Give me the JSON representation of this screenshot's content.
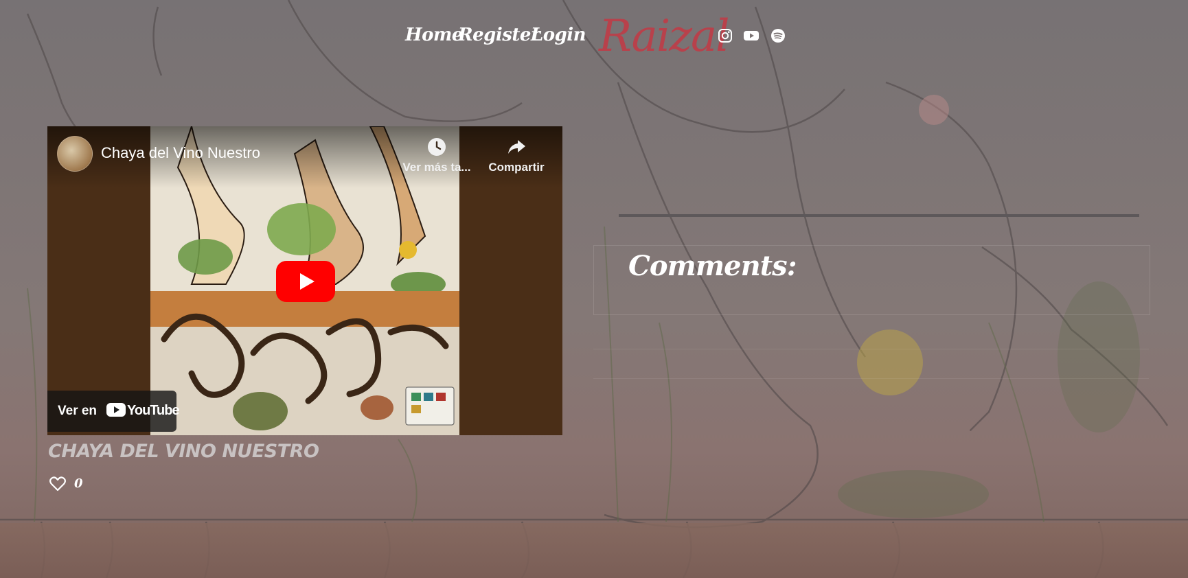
{
  "nav": {
    "home": "Home",
    "register": "Register",
    "login": "Login",
    "logo": "Raizal",
    "social": [
      "instagram-icon",
      "youtube-icon",
      "spotify-icon"
    ]
  },
  "video": {
    "title": "Chaya del Vino Nuestro",
    "watch_later": "Ver más ta...",
    "share": "Compartir",
    "watch_on": "Ver en",
    "youtube_wordmark": "YouTube"
  },
  "post": {
    "title": "CHAYA DEL VINO NUESTRO",
    "likes": "0"
  },
  "comments": {
    "heading": "Comments:"
  },
  "colors": {
    "logo": "#b8414b",
    "video_frame": "#4a2e17",
    "youtube_red": "#ff0000"
  }
}
